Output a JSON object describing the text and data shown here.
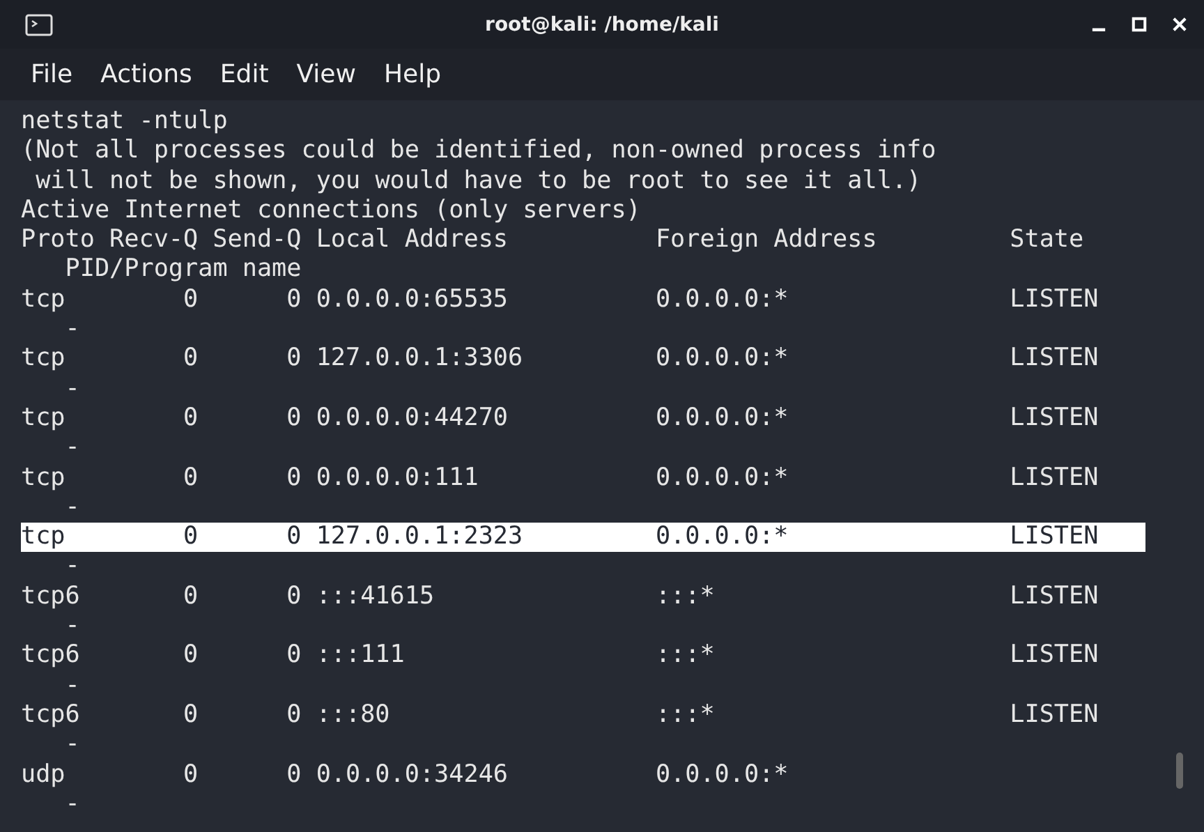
{
  "window": {
    "title": "root@kali: /home/kali"
  },
  "menu": [
    "File",
    "Actions",
    "Edit",
    "View",
    "Help"
  ],
  "terminal": {
    "command": "netstat -ntulp",
    "messages": [
      "(Not all processes could be identified, non-owned process info",
      " will not be shown, you would have to be root to see it all.)",
      "Active Internet connections (only servers)"
    ],
    "columns": {
      "proto": "Proto",
      "recv_q": "Recv-Q",
      "send_q": "Send-Q",
      "local": "Local Address",
      "foreign": "Foreign Address",
      "state": "State",
      "pid": "PID/Program name"
    },
    "rows": [
      {
        "proto": "tcp",
        "recv_q": "0",
        "send_q": "0",
        "local": "0.0.0.0:65535",
        "foreign": "0.0.0.0:*",
        "state": "LISTEN",
        "pid": "-",
        "selected": false
      },
      {
        "proto": "tcp",
        "recv_q": "0",
        "send_q": "0",
        "local": "127.0.0.1:3306",
        "foreign": "0.0.0.0:*",
        "state": "LISTEN",
        "pid": "-",
        "selected": false
      },
      {
        "proto": "tcp",
        "recv_q": "0",
        "send_q": "0",
        "local": "0.0.0.0:44270",
        "foreign": "0.0.0.0:*",
        "state": "LISTEN",
        "pid": "-",
        "selected": false
      },
      {
        "proto": "tcp",
        "recv_q": "0",
        "send_q": "0",
        "local": "0.0.0.0:111",
        "foreign": "0.0.0.0:*",
        "state": "LISTEN",
        "pid": "-",
        "selected": false
      },
      {
        "proto": "tcp",
        "recv_q": "0",
        "send_q": "0",
        "local": "127.0.0.1:2323",
        "foreign": "0.0.0.0:*",
        "state": "LISTEN",
        "pid": "-",
        "selected": true
      },
      {
        "proto": "tcp6",
        "recv_q": "0",
        "send_q": "0",
        "local": ":::41615",
        "foreign": ":::*",
        "state": "LISTEN",
        "pid": "-",
        "selected": false
      },
      {
        "proto": "tcp6",
        "recv_q": "0",
        "send_q": "0",
        "local": ":::111",
        "foreign": ":::*",
        "state": "LISTEN",
        "pid": "-",
        "selected": false
      },
      {
        "proto": "tcp6",
        "recv_q": "0",
        "send_q": "0",
        "local": ":::80",
        "foreign": ":::*",
        "state": "LISTEN",
        "pid": "-",
        "selected": false
      },
      {
        "proto": "udp",
        "recv_q": "0",
        "send_q": "0",
        "local": "0.0.0.0:34246",
        "foreign": "0.0.0.0:*",
        "pid": "-",
        "selected": false
      }
    ]
  }
}
